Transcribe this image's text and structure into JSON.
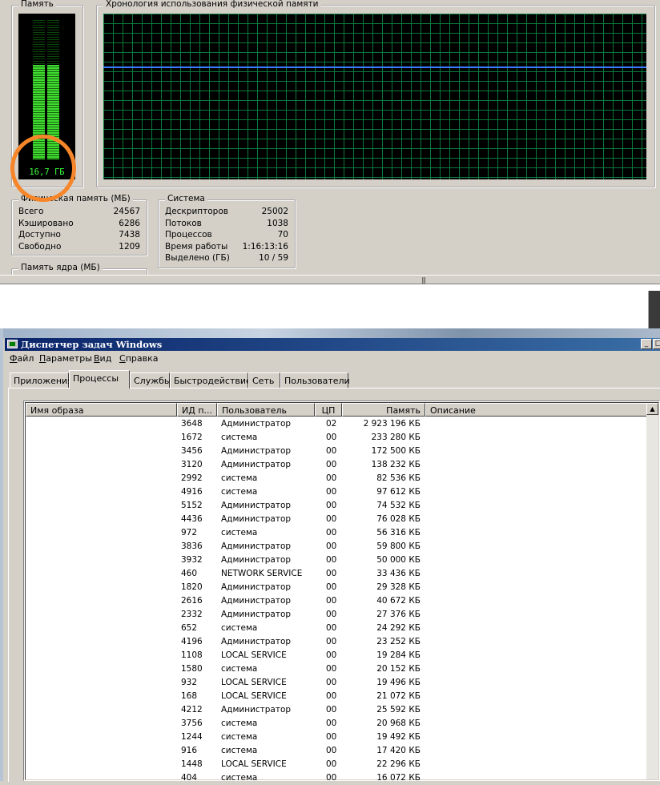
{
  "performance": {
    "memory": {
      "title": "Память",
      "value": "16,7 ГБ",
      "usage_fraction": 0.68
    },
    "history": {
      "title": "Хронология использования физической памяти",
      "usage_fraction": 0.68
    },
    "physical_memory": {
      "title": "Физическая память (МБ)",
      "rows": [
        {
          "label": "Всего",
          "value": "24567"
        },
        {
          "label": "Кэшировано",
          "value": "6286"
        },
        {
          "label": "Доступно",
          "value": "7438"
        },
        {
          "label": "Свободно",
          "value": "1209"
        }
      ]
    },
    "system": {
      "title": "Система",
      "rows": [
        {
          "label": "Дескрипторов",
          "value": "25002"
        },
        {
          "label": "Потоков",
          "value": "1038"
        },
        {
          "label": "Процессов",
          "value": "70"
        },
        {
          "label": "Время работы",
          "value": "1:16:13:16"
        },
        {
          "label": "Выделено (ГБ)",
          "value": "10 / 59"
        }
      ]
    },
    "kernel_memory": {
      "title": "Память ядра (МБ)"
    },
    "grip": "|||"
  },
  "window": {
    "title": "Диспетчер задач Windows",
    "minimize_glyph": "_",
    "restore_glyph": "□"
  },
  "menu": [
    {
      "prefix": "",
      "ul": "Ф",
      "rest": "айл"
    },
    {
      "prefix": "",
      "ul": "П",
      "rest": "араметры"
    },
    {
      "prefix": "",
      "ul": "В",
      "rest": "ид"
    },
    {
      "prefix": "",
      "ul": "С",
      "rest": "правка"
    }
  ],
  "tabs": [
    "Приложения",
    "Процессы",
    "Службы",
    "Быстродействие",
    "Сеть",
    "Пользователи"
  ],
  "active_tab": 1,
  "columns": [
    "Имя образа",
    "ИД п...",
    "Пользователь",
    "ЦП",
    "Память",
    "Описание"
  ],
  "scroll_up_glyph": "▲",
  "processes": [
    {
      "pid": "3648",
      "user": "Администратор",
      "cpu": "02",
      "mem": "2 923 196 КБ"
    },
    {
      "pid": "1672",
      "user": "система",
      "cpu": "00",
      "mem": "233 280 КБ"
    },
    {
      "pid": "3456",
      "user": "Администратор",
      "cpu": "00",
      "mem": "172 500 КБ"
    },
    {
      "pid": "3120",
      "user": "Администратор",
      "cpu": "00",
      "mem": "138 232 КБ"
    },
    {
      "pid": "2992",
      "user": "система",
      "cpu": "00",
      "mem": "82 536 КБ"
    },
    {
      "pid": "4916",
      "user": "система",
      "cpu": "00",
      "mem": "97 612 КБ"
    },
    {
      "pid": "5152",
      "user": "Администратор",
      "cpu": "00",
      "mem": "74 532 КБ"
    },
    {
      "pid": "4436",
      "user": "Администратор",
      "cpu": "00",
      "mem": "76 028 КБ"
    },
    {
      "pid": "972",
      "user": "система",
      "cpu": "00",
      "mem": "56 316 КБ"
    },
    {
      "pid": "3836",
      "user": "Администратор",
      "cpu": "00",
      "mem": "59 800 КБ"
    },
    {
      "pid": "3932",
      "user": "Администратор",
      "cpu": "00",
      "mem": "50 000 КБ"
    },
    {
      "pid": "460",
      "user": "NETWORK SERVICE",
      "cpu": "00",
      "mem": "33 436 КБ"
    },
    {
      "pid": "1820",
      "user": "Администратор",
      "cpu": "00",
      "mem": "29 328 КБ"
    },
    {
      "pid": "2616",
      "user": "Администратор",
      "cpu": "00",
      "mem": "40 672 КБ"
    },
    {
      "pid": "2332",
      "user": "Администратор",
      "cpu": "00",
      "mem": "27 376 КБ"
    },
    {
      "pid": "652",
      "user": "система",
      "cpu": "00",
      "mem": "24 292 КБ"
    },
    {
      "pid": "4196",
      "user": "Администратор",
      "cpu": "00",
      "mem": "23 252 КБ"
    },
    {
      "pid": "1108",
      "user": "LOCAL SERVICE",
      "cpu": "00",
      "mem": "19 284 КБ"
    },
    {
      "pid": "1580",
      "user": "система",
      "cpu": "00",
      "mem": "20 152 КБ"
    },
    {
      "pid": "932",
      "user": "LOCAL SERVICE",
      "cpu": "00",
      "mem": "19 496 КБ"
    },
    {
      "pid": "168",
      "user": "LOCAL SERVICE",
      "cpu": "00",
      "mem": "21 072 КБ"
    },
    {
      "pid": "4212",
      "user": "Администратор",
      "cpu": "00",
      "mem": "25 592 КБ"
    },
    {
      "pid": "3756",
      "user": "система",
      "cpu": "00",
      "mem": "20 968 КБ"
    },
    {
      "pid": "1244",
      "user": "система",
      "cpu": "00",
      "mem": "19 492 КБ"
    },
    {
      "pid": "916",
      "user": "система",
      "cpu": "00",
      "mem": "17 420 КБ"
    },
    {
      "pid": "1448",
      "user": "LOCAL SERVICE",
      "cpu": "00",
      "mem": "22 296 КБ"
    },
    {
      "pid": "404",
      "user": "система",
      "cpu": "00",
      "mem": "16 072 КБ"
    }
  ],
  "colors": {
    "meter_green": "#3fdc2f",
    "history_line": "#3b7bff",
    "grid": "#0b7a3c",
    "highlight_ring": "#f7862a",
    "titlebar": "#0a246a"
  }
}
